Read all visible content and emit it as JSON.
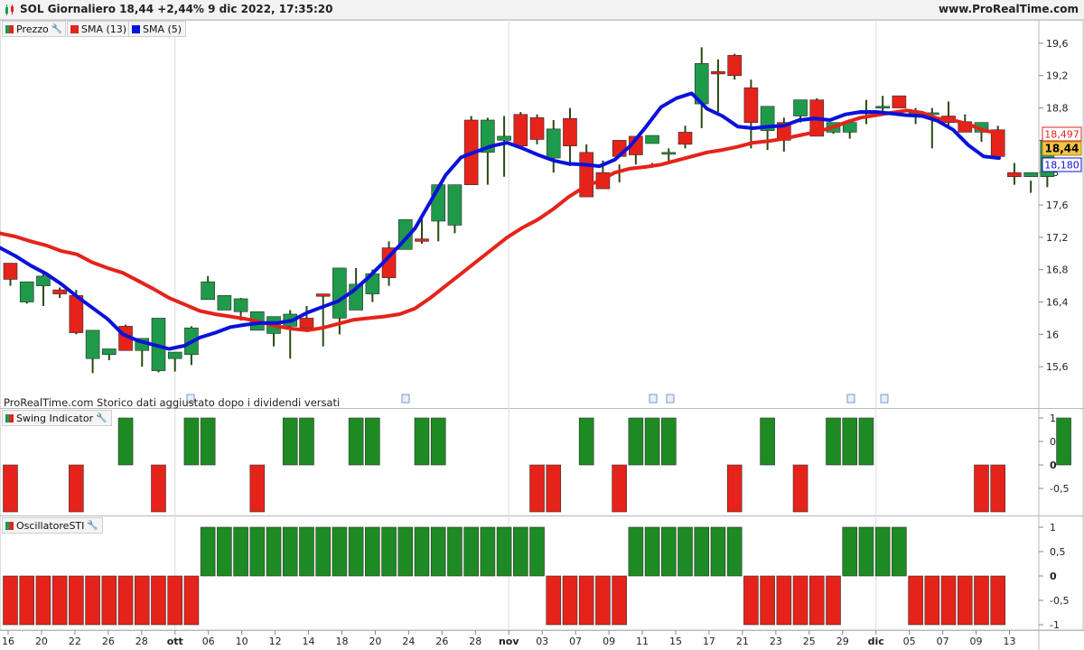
{
  "header": {
    "title": "SOL Giornaliero 18,44 +2,44% 9 dic 2022, 17:35:20",
    "website": "www.ProRealTime.com"
  },
  "price_panel": {
    "legend": [
      {
        "label": "Prezzo",
        "color": "#e5231b"
      },
      {
        "label": "SMA (13)",
        "color": "#e5231b"
      },
      {
        "label": "SMA (5)",
        "color": "#0a12d9"
      }
    ],
    "note": "ProRealTime.com Storico dati aggiustato dopo i dividendi versati",
    "badges": {
      "sma13": "18,497",
      "price": "18,44",
      "sma5": "18,180"
    }
  },
  "swing_panel": {
    "legend": "Swing Indicator"
  },
  "sti_panel": {
    "legend": "OscillatoreSTI"
  },
  "colors": {
    "up": "#1f9a4a",
    "down": "#e5231b",
    "sma13": "#e5231b",
    "sma5": "#0a12d9",
    "bar_green": "#1e8a23",
    "bar_red": "#e5231b"
  },
  "chart_data": [
    {
      "type": "candlestick",
      "title": "SOL Giornaliero",
      "ylim": [
        15.2,
        19.8
      ],
      "yticks": [
        "15,6",
        "16",
        "16,4",
        "16,8",
        "17,2",
        "17,6",
        "18",
        "18,4",
        "18,8",
        "19,2",
        "19,6"
      ],
      "x_tick_labels": [
        "16",
        "20",
        "22",
        "26",
        "28",
        "ott",
        "06",
        "10",
        "12",
        "14",
        "18",
        "20",
        "24",
        "26",
        "28",
        "nov",
        "03",
        "07",
        "09",
        "11",
        "15",
        "17",
        "21",
        "23",
        "25",
        "29",
        "dic",
        "05",
        "07",
        "09",
        "13"
      ],
      "ohlc": [
        [
          16.88,
          16.88,
          16.6,
          16.68
        ],
        [
          16.4,
          16.62,
          16.38,
          16.65
        ],
        [
          16.6,
          16.75,
          16.35,
          16.72
        ],
        [
          16.55,
          16.58,
          16.45,
          16.5
        ],
        [
          16.48,
          16.55,
          16.0,
          16.02
        ],
        [
          15.7,
          16.04,
          15.52,
          16.05
        ],
        [
          15.75,
          15.8,
          15.68,
          15.82
        ],
        [
          16.1,
          16.12,
          15.8,
          15.8
        ],
        [
          15.8,
          15.87,
          15.6,
          15.95
        ],
        [
          15.55,
          16.2,
          15.53,
          16.2
        ],
        [
          15.7,
          15.78,
          15.54,
          15.78
        ],
        [
          15.75,
          16.1,
          15.62,
          16.08
        ],
        [
          16.43,
          16.72,
          16.45,
          16.65
        ],
        [
          16.3,
          16.48,
          16.3,
          16.48
        ],
        [
          16.28,
          16.45,
          16.17,
          16.44
        ],
        [
          16.05,
          16.28,
          16.05,
          16.28
        ],
        [
          16.01,
          16.21,
          15.85,
          16.22
        ],
        [
          16.1,
          16.3,
          15.7,
          16.25
        ],
        [
          16.2,
          16.35,
          16.03,
          16.08
        ],
        [
          16.5,
          16.5,
          15.85,
          16.47
        ],
        [
          16.2,
          16.82,
          16.0,
          16.82
        ],
        [
          16.3,
          16.82,
          16.3,
          16.62
        ],
        [
          16.5,
          16.8,
          16.4,
          16.75
        ],
        [
          17.07,
          17.15,
          16.6,
          16.7
        ],
        [
          17.05,
          17.4,
          17.05,
          17.42
        ],
        [
          17.18,
          17.45,
          17.12,
          17.15
        ],
        [
          17.4,
          17.85,
          17.15,
          17.85
        ],
        [
          17.35,
          17.85,
          17.25,
          17.85
        ],
        [
          18.65,
          18.7,
          17.85,
          17.85
        ],
        [
          18.25,
          18.68,
          17.85,
          18.65
        ],
        [
          18.4,
          18.7,
          17.95,
          18.45
        ],
        [
          18.72,
          18.75,
          18.32,
          18.33
        ],
        [
          18.68,
          18.72,
          18.35,
          18.41
        ],
        [
          18.18,
          18.65,
          18.0,
          18.54
        ],
        [
          18.67,
          18.8,
          18.08,
          18.33
        ],
        [
          18.25,
          18.35,
          17.75,
          17.7
        ],
        [
          18.0,
          18.15,
          17.88,
          17.8
        ],
        [
          18.4,
          18.1,
          17.88,
          18.2
        ],
        [
          18.45,
          18.4,
          18.1,
          18.22
        ],
        [
          18.36,
          18.12,
          18.06,
          18.46
        ],
        [
          18.25,
          18.3,
          18.12,
          18.25
        ],
        [
          18.5,
          18.58,
          18.3,
          18.35
        ],
        [
          18.85,
          19.55,
          18.55,
          19.35
        ],
        [
          19.25,
          19.4,
          18.75,
          19.22
        ],
        [
          19.45,
          19.47,
          19.15,
          19.2
        ],
        [
          19.05,
          19.15,
          18.3,
          18.62
        ],
        [
          18.52,
          18.75,
          18.28,
          18.82
        ],
        [
          18.62,
          18.68,
          18.26,
          18.4
        ],
        [
          18.7,
          18.9,
          18.62,
          18.9
        ],
        [
          18.9,
          18.92,
          18.5,
          18.45
        ],
        [
          18.5,
          18.5,
          18.48,
          18.62
        ],
        [
          18.5,
          18.62,
          18.42,
          18.62
        ],
        [
          18.75,
          18.9,
          18.6,
          18.75
        ],
        [
          18.82,
          18.95,
          18.72,
          18.82
        ],
        [
          18.95,
          18.95,
          18.85,
          18.8
        ],
        [
          18.74,
          18.8,
          18.6,
          18.75
        ],
        [
          18.74,
          18.8,
          18.3,
          18.74
        ],
        [
          18.7,
          18.88,
          18.55,
          18.62
        ],
        [
          18.63,
          18.72,
          18.55,
          18.5
        ],
        [
          18.5,
          18.62,
          18.38,
          18.62
        ],
        [
          18.53,
          18.58,
          18.3,
          18.2
        ],
        [
          18.0,
          18.12,
          17.85,
          17.95
        ],
        [
          17.95,
          17.9,
          17.75,
          18.0
        ],
        [
          17.95,
          18.4,
          17.82,
          18.4
        ]
      ],
      "series": [
        {
          "name": "SMA (13)",
          "values": [
            17.25,
            17.21,
            17.15,
            17.1,
            17.03,
            16.99,
            16.89,
            16.82,
            16.76,
            16.66,
            16.56,
            16.45,
            16.37,
            16.29,
            16.25,
            16.22,
            16.19,
            16.15,
            16.1,
            16.07,
            16.05,
            16.08,
            16.13,
            16.18,
            16.2,
            16.22,
            16.25,
            16.32,
            16.45,
            16.6,
            16.75,
            16.9,
            17.05,
            17.2,
            17.32,
            17.42,
            17.55,
            17.7,
            17.82,
            17.9,
            18.0,
            18.05,
            18.07,
            18.1,
            18.15,
            18.2,
            18.25,
            18.28,
            18.32,
            18.37,
            18.39,
            18.42,
            18.46,
            18.5,
            18.55,
            18.62,
            18.68,
            18.71,
            18.74,
            18.77,
            18.74,
            18.67,
            18.65,
            18.6,
            18.52,
            18.49
          ]
        },
        {
          "name": "SMA (5)",
          "values": [
            17.07,
            16.97,
            16.85,
            16.75,
            16.62,
            16.47,
            16.33,
            16.19,
            16.0,
            15.92,
            15.87,
            15.82,
            15.86,
            15.96,
            16.02,
            16.09,
            16.12,
            16.14,
            16.14,
            16.17,
            16.27,
            16.34,
            16.41,
            16.54,
            16.71,
            16.9,
            17.1,
            17.31,
            17.64,
            17.97,
            18.19,
            18.26,
            18.33,
            18.37,
            18.3,
            18.22,
            18.15,
            18.11,
            18.1,
            18.08,
            18.16,
            18.33,
            18.56,
            18.81,
            18.92,
            18.98,
            18.79,
            18.7,
            18.57,
            18.55,
            18.57,
            18.58,
            18.65,
            18.67,
            18.65,
            18.72,
            18.75,
            18.75,
            18.73,
            18.71,
            18.7,
            18.64,
            18.53,
            18.34,
            18.2,
            18.18
          ]
        }
      ]
    },
    {
      "type": "bar",
      "title": "Swing Indicator",
      "ylim": [
        -1,
        1
      ],
      "yticks": [
        "1",
        "0,5",
        "0",
        "-0,5"
      ],
      "values": [
        -1,
        0,
        0,
        0,
        -1,
        0,
        0,
        1,
        0,
        -1,
        0,
        1,
        1,
        0,
        0,
        -1,
        0,
        1,
        1,
        0,
        0,
        1,
        1,
        0,
        0,
        1,
        1,
        0,
        0,
        0,
        0,
        0,
        -1,
        -1,
        0,
        1,
        0,
        -1,
        1,
        1,
        1,
        0,
        0,
        0,
        -1,
        0,
        1,
        0,
        -1,
        0,
        1,
        1,
        1,
        0,
        0,
        0,
        0,
        0,
        0,
        -1,
        -1,
        0,
        0,
        0,
        1
      ]
    },
    {
      "type": "bar",
      "title": "OscillatoreSTI",
      "ylim": [
        -1,
        1
      ],
      "yticks": [
        "1",
        "0,5",
        "0",
        "-0,5",
        "-1"
      ],
      "values": [
        -1,
        -1,
        -1,
        -1,
        -1,
        -1,
        -1,
        -1,
        -1,
        -1,
        -1,
        -1,
        1,
        1,
        1,
        1,
        1,
        1,
        1,
        1,
        1,
        1,
        1,
        1,
        1,
        1,
        1,
        1,
        1,
        1,
        1,
        1,
        1,
        -1,
        -1,
        -1,
        -1,
        -1,
        1,
        1,
        1,
        1,
        1,
        1,
        1,
        -1,
        -1,
        -1,
        -1,
        -1,
        -1,
        1,
        1,
        1,
        1,
        -1,
        -1,
        -1,
        -1,
        -1,
        -1
      ]
    }
  ]
}
